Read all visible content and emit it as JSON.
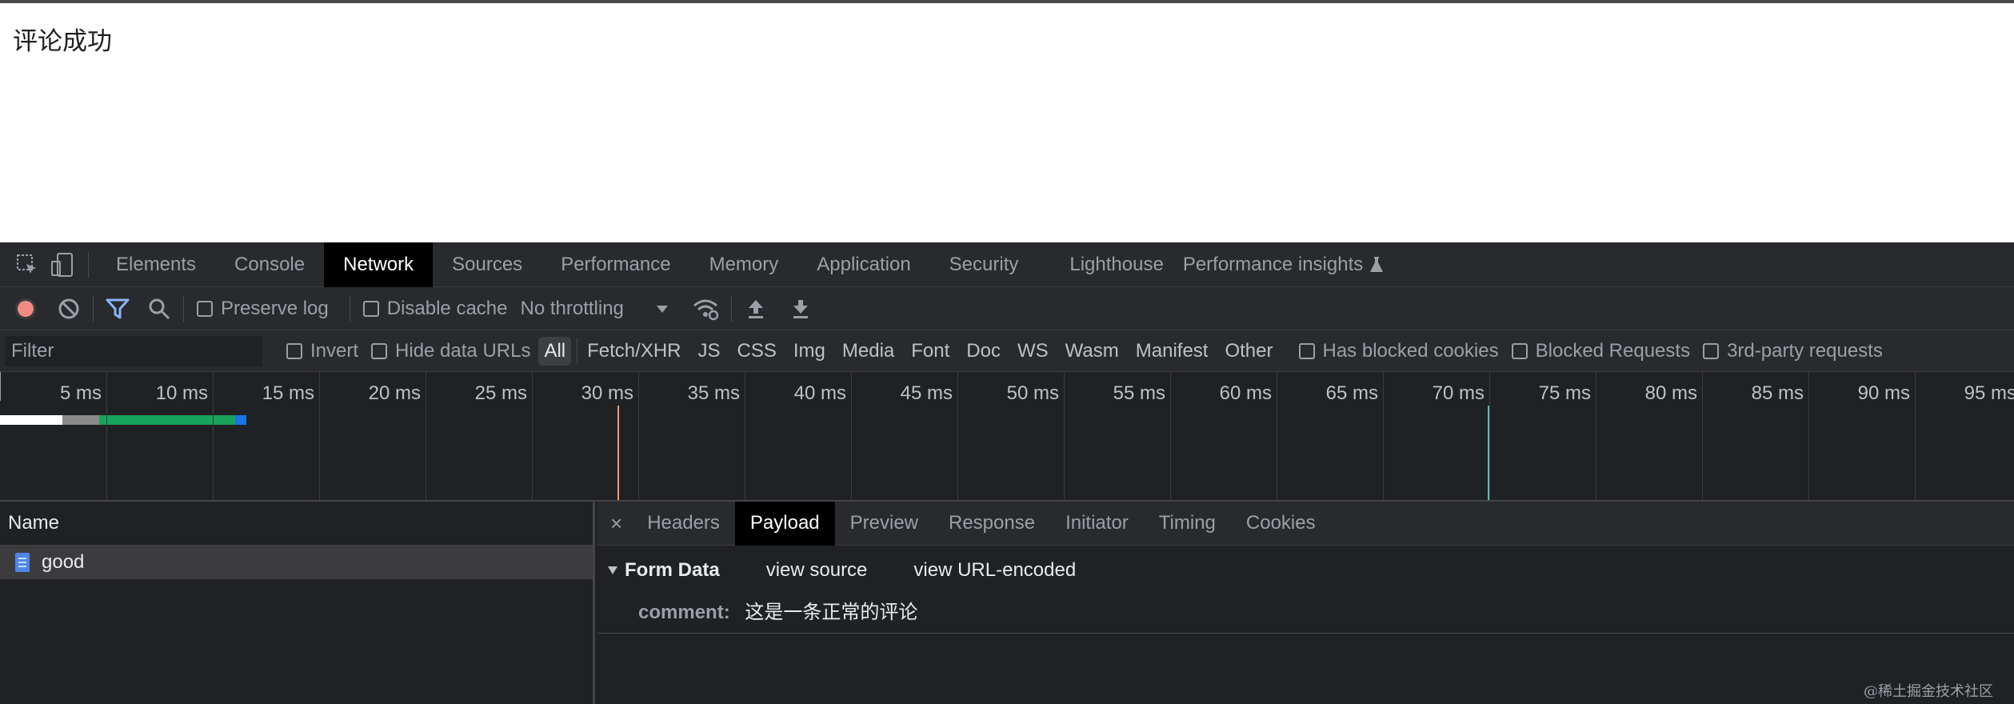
{
  "page": {
    "message": "评论成功"
  },
  "devtools": {
    "tabs": [
      "Elements",
      "Console",
      "Network",
      "Sources",
      "Performance",
      "Memory",
      "Application",
      "Security",
      "Lighthouse",
      "Performance insights"
    ],
    "active_tab": "Network"
  },
  "toolbar": {
    "preserve_log": "Preserve log",
    "disable_cache": "Disable cache",
    "throttling": "No throttling"
  },
  "filter": {
    "placeholder": "Filter",
    "invert": "Invert",
    "hide_data_urls": "Hide data URLs",
    "types": [
      "All",
      "Fetch/XHR",
      "JS",
      "CSS",
      "Img",
      "Media",
      "Font",
      "Doc",
      "WS",
      "Wasm",
      "Manifest",
      "Other"
    ],
    "has_blocked_cookies": "Has blocked cookies",
    "blocked_requests": "Blocked Requests",
    "third_party": "3rd-party requests"
  },
  "timeline": {
    "ticks": [
      "5 ms",
      "10 ms",
      "15 ms",
      "20 ms",
      "25 ms",
      "30 ms",
      "35 ms",
      "40 ms",
      "45 ms",
      "50 ms",
      "55 ms",
      "60 ms",
      "65 ms",
      "70 ms",
      "75 ms",
      "80 ms",
      "85 ms",
      "90 ms",
      "95 ms"
    ],
    "colors": {
      "dom_content_loaded": "#f29b6a",
      "load": "#4fc0b0"
    }
  },
  "requests": {
    "header": "Name",
    "items": [
      {
        "name": "good"
      }
    ]
  },
  "details": {
    "close": "×",
    "tabs": [
      "Headers",
      "Payload",
      "Preview",
      "Response",
      "Initiator",
      "Timing",
      "Cookies"
    ],
    "active_tab": "Payload",
    "form_data": {
      "title": "Form Data",
      "view_source": "view source",
      "view_url_encoded": "view URL-encoded",
      "fields": [
        {
          "key": "comment:",
          "value": "这是一条正常的评论"
        }
      ]
    }
  },
  "watermark": "@稀土掘金技术社区"
}
